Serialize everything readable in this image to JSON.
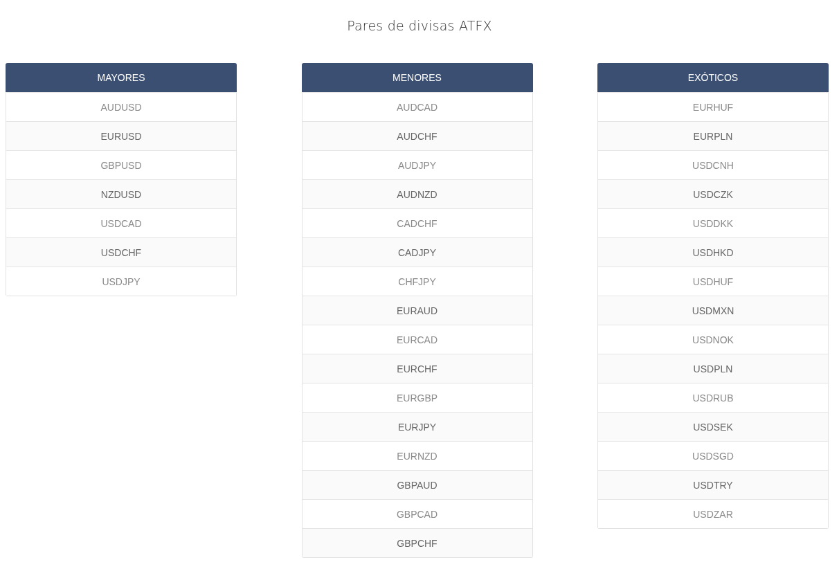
{
  "title": "Pares de divisas ATFX",
  "tables": [
    {
      "heading": "MAYORES",
      "rows": [
        "AUDUSD",
        "EURUSD",
        "GBPUSD",
        "NZDUSD",
        "USDCAD",
        "USDCHF",
        "USDJPY"
      ]
    },
    {
      "heading": "MENORES",
      "rows": [
        "AUDCAD",
        "AUDCHF",
        "AUDJPY",
        "AUDNZD",
        "CADCHF",
        "CADJPY",
        "CHFJPY",
        "EURAUD",
        "EURCAD",
        "EURCHF",
        "EURGBP",
        "EURJPY",
        "EURNZD",
        "GBPAUD",
        "GBPCAD",
        "GBPCHF"
      ]
    },
    {
      "heading": "EXÓTICOS",
      "rows": [
        "EURHUF",
        "EURPLN",
        "USDCNH",
        "USDCZK",
        "USDDKK",
        "USDHKD",
        "USDHUF",
        "USDMXN",
        "USDNOK",
        "USDPLN",
        "USDRUB",
        "USDSEK",
        "USDSGD",
        "USDTRY",
        "USDZAR"
      ]
    }
  ]
}
